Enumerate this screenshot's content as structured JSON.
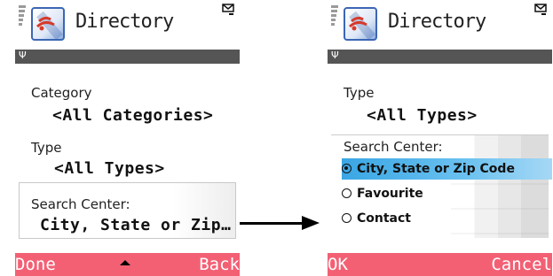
{
  "left_screen": {
    "title": "Directory",
    "fields": [
      {
        "label": "Category",
        "value": "<All Categories>"
      },
      {
        "label": "Type",
        "value": "<All Types>"
      },
      {
        "label": "Search Center:",
        "value": "City, State or Zip…"
      }
    ],
    "softkeys": {
      "left": "Done",
      "right": "Back"
    }
  },
  "right_screen": {
    "title": "Directory",
    "fields": [
      {
        "label": "Type",
        "value": "<All Types>"
      }
    ],
    "popup": {
      "label": "Search Center:",
      "options": [
        {
          "label": "City, State or Zip Code",
          "selected": true
        },
        {
          "label": "Favourite",
          "selected": false
        },
        {
          "label": "Contact",
          "selected": false
        }
      ]
    },
    "softkeys": {
      "left": "OK",
      "right": "Cancel"
    }
  },
  "colors": {
    "softkey_bar": "#f36074",
    "highlight": "#3aa6e4",
    "status_strip": "#555555"
  },
  "icons": [
    "signal-bars-icon",
    "directory-app-icon",
    "mail-icon",
    "antenna-icon",
    "scroll-up-icon",
    "radio-icon",
    "arrow-icon"
  ]
}
